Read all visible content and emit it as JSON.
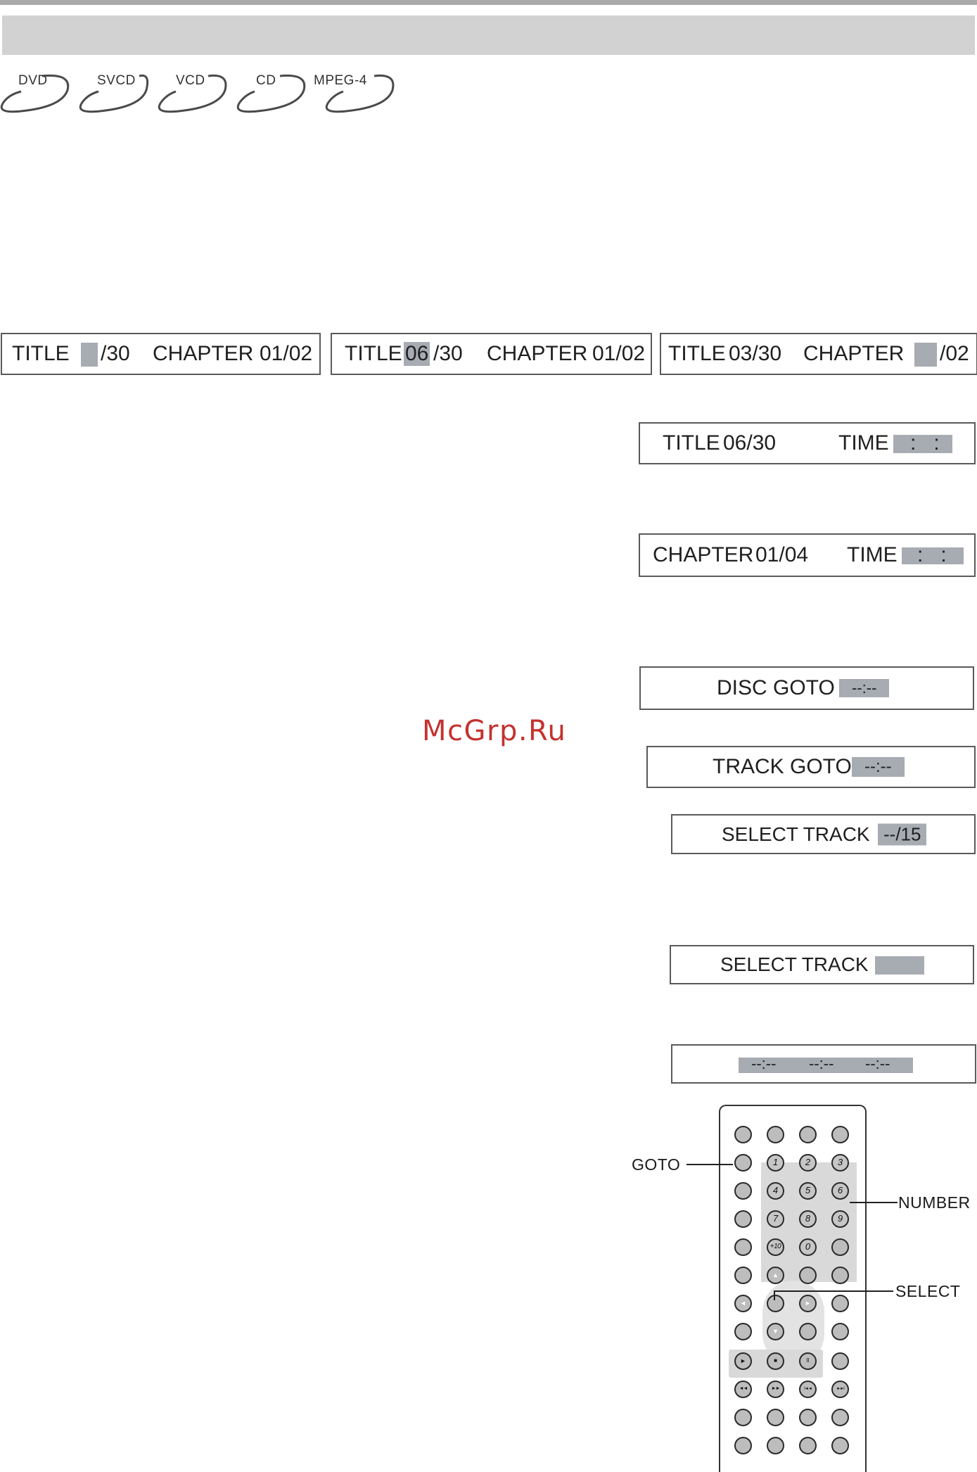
{
  "disc_types": [
    "DVD",
    "SVCD",
    "VCD",
    "CD",
    "MPEG-4"
  ],
  "osd": {
    "box1": {
      "title": "TITLE",
      "title_val": "/30",
      "chapter": "CHAPTER",
      "chapter_val": "01/02"
    },
    "box2": {
      "title": "TITLE",
      "title_sel": "06",
      "title_val": "/30",
      "chapter": "CHAPTER",
      "chapter_val": "01/02"
    },
    "box3": {
      "title": "TITLE",
      "title_val": "03/30",
      "chapter": "CHAPTER",
      "chapter_val": "/02"
    },
    "box4": {
      "title": "TITLE",
      "title_val": "06/30",
      "time": "TIME",
      "time_val": ":   :"
    },
    "box5": {
      "chapter": "CHAPTER",
      "chapter_val": "01/04",
      "time": "TIME",
      "time_val": ":   :"
    },
    "box6": {
      "label": "DISC GOTO",
      "value": "--:--"
    },
    "box7": {
      "label": "TRACK GOTO",
      "value": "--:--"
    },
    "box8": {
      "label": "SELECT TRACK",
      "value": "--/15"
    },
    "box9": {
      "label": "SELECT TRACK",
      "value": ""
    },
    "box10": {
      "v1": "--:--",
      "v2": "--:--",
      "v3": "--:--"
    }
  },
  "watermark": "McGrp.Ru",
  "remote": {
    "callouts": {
      "goto": "GOTO",
      "number": "NUMBER",
      "select": "SELECT"
    },
    "number_keys": [
      "1",
      "2",
      "3",
      "4",
      "5",
      "6",
      "7",
      "8",
      "9",
      "+10",
      "0"
    ],
    "arrow_glyphs": {
      "up": "▲",
      "down": "▼",
      "left": "◄",
      "right": "►"
    },
    "transport_glyphs": {
      "play": "►",
      "stop": "■",
      "pause": "II",
      "rew": "◄◄",
      "ff": "►►",
      "prev": "I◄◄",
      "next": "►►I"
    }
  }
}
